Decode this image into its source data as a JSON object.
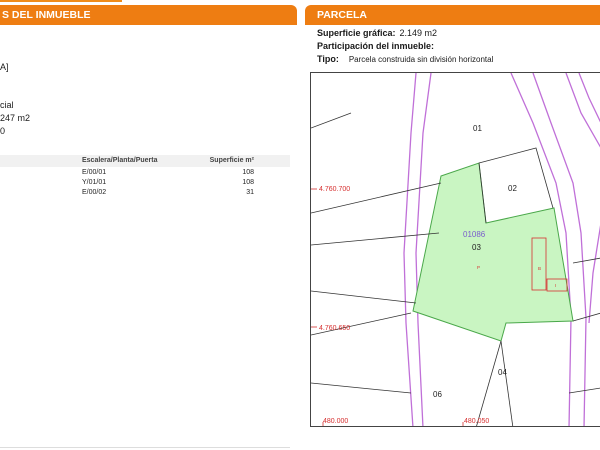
{
  "left_panel": {
    "header_title": "S DEL INMUEBLE",
    "fragments": [
      "A]",
      "cial",
      "247 m2",
      "0"
    ],
    "table": {
      "headers": [
        "Escalera/Planta/Puerta",
        "Superficie m²"
      ],
      "rows": [
        {
          "location": "E/00/01",
          "surface": "108"
        },
        {
          "location": "Y/01/01",
          "surface": "108"
        },
        {
          "location": "E/00/02",
          "surface": "31"
        }
      ]
    }
  },
  "right_panel": {
    "header_title": "PARCELA",
    "superficie_label": "Superficie gráfica:",
    "superficie_value": "2.149 m2",
    "participacion_label": "Participación del inmueble:",
    "tipo_label": "Tipo:",
    "tipo_value": "Parcela construida sin división horizontal"
  },
  "map": {
    "parcel_labels": [
      "01",
      "02",
      "03",
      "04",
      "06"
    ],
    "parcel_ref": "01086",
    "coord_labels": [
      "4.760.700",
      "4.760.650",
      "480.000",
      "480.050"
    ],
    "building_marks": [
      "P",
      "B",
      "I"
    ],
    "colors": {
      "parcel_fill": "#c9f5c2",
      "parcel_stroke": "#4aa84a",
      "road": "#c070d8",
      "coord": "#d63030",
      "ref": "#7a5ccc"
    }
  }
}
